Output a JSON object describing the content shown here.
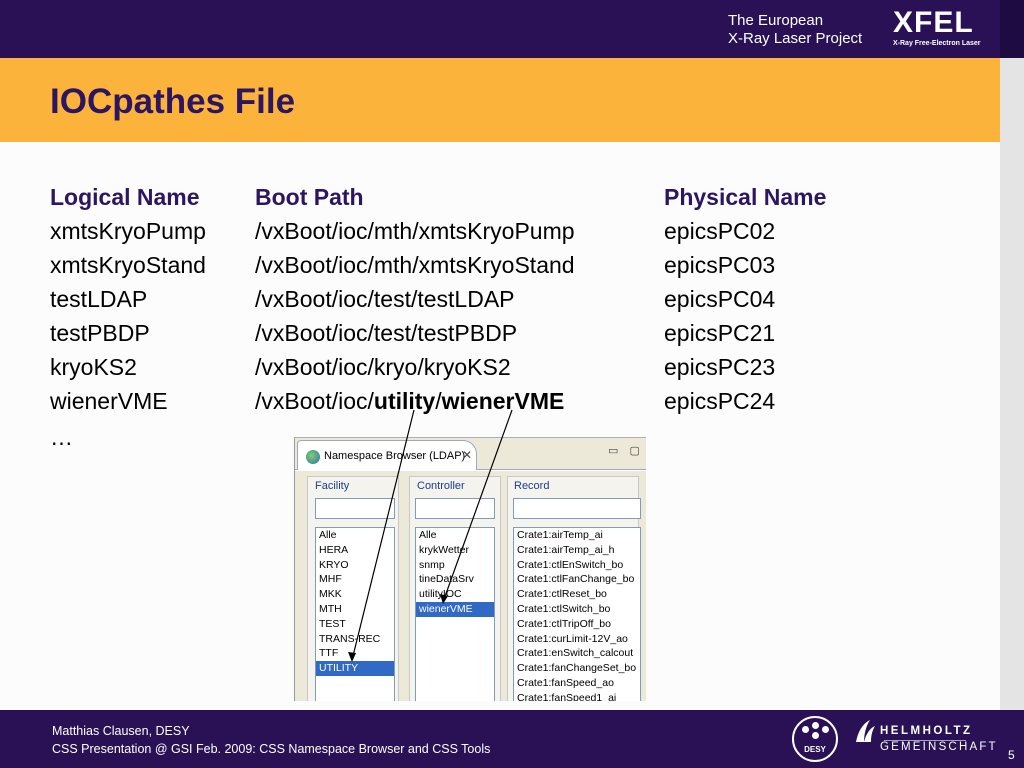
{
  "header": {
    "project_line1": "The European",
    "project_line2": "X-Ray Laser Project",
    "logo": "XFEL",
    "logo_sub": "X-Ray Free-Electron Laser"
  },
  "slide": {
    "title": "IOCpathes File"
  },
  "table": {
    "headers": [
      "Logical Name",
      "Boot Path",
      "Physical Name"
    ],
    "rows": [
      {
        "logical": "xmtsKryoPump",
        "boot": "/vxBoot/ioc/mth/xmtsKryoPump",
        "physical": "epicsPC02"
      },
      {
        "logical": "xmtsKryoStand",
        "boot": "/vxBoot/ioc/mth/xmtsKryoStand",
        "physical": "epicsPC03"
      },
      {
        "logical": "testLDAP",
        "boot": "/vxBoot/ioc/test/testLDAP",
        "physical": "epicsPC04"
      },
      {
        "logical": "testPBDP",
        "boot": "/vxBoot/ioc/test/testPBDP",
        "physical": "epicsPC21"
      },
      {
        "logical": "kryoKS2",
        "boot": "/vxBoot/ioc/kryo/kryoKS2",
        "physical": "epicsPC23"
      },
      {
        "logical": "wienerVME",
        "boot_prefix": "/vxBoot/ioc/",
        "boot_bold1": "utility",
        "boot_sep": "/",
        "boot_bold2": "wienerVME",
        "physical": "epicsPC24"
      }
    ],
    "ellipsis": "…"
  },
  "namespace_browser": {
    "tab_title": "Namespace Browser (LDAP)",
    "close_glyph": "✕",
    "window_buttons": "▭ ▢",
    "facility": {
      "label": "Facility",
      "filter_value": "",
      "items": [
        "Alle",
        "HERA",
        "KRYO",
        "MHF",
        "MKK",
        "MTH",
        "TEST",
        "TRANS-REC",
        "TTF",
        "UTILITY"
      ],
      "selected": "UTILITY"
    },
    "controller": {
      "label": "Controller",
      "filter_value": "",
      "items": [
        "Alle",
        "krykWetter",
        "snmp",
        "tineDataSrv",
        "utilityIOC",
        "wienerVME"
      ],
      "selected": "wienerVME"
    },
    "record": {
      "label": "Record",
      "filter_value": "",
      "items": [
        "Crate1:airTemp_ai",
        "Crate1:airTemp_ai_h",
        "Crate1:ctlEnSwitch_bo",
        "Crate1:ctlFanChange_bo",
        "Crate1:ctlReset_bo",
        "Crate1:ctlSwitch_bo",
        "Crate1:ctlTripOff_bo",
        "Crate1:curLimit-12V_ao",
        "Crate1:enSwitch_calcout",
        "Crate1:fanChangeSet_bo",
        "Crate1:fanSpeed_ao",
        "Crate1:fanSpeed1_ai"
      ]
    }
  },
  "footer": {
    "author": "Matthias Clausen, DESY",
    "event": "CSS Presentation @ GSI Feb. 2009: CSS Namespace Browser and CSS Tools",
    "desy_logo": "DESY",
    "helmholtz_line1": "HELMHOLTZ",
    "helmholtz_line2": "GEMEINSCHAFT",
    "page_number": "5"
  }
}
